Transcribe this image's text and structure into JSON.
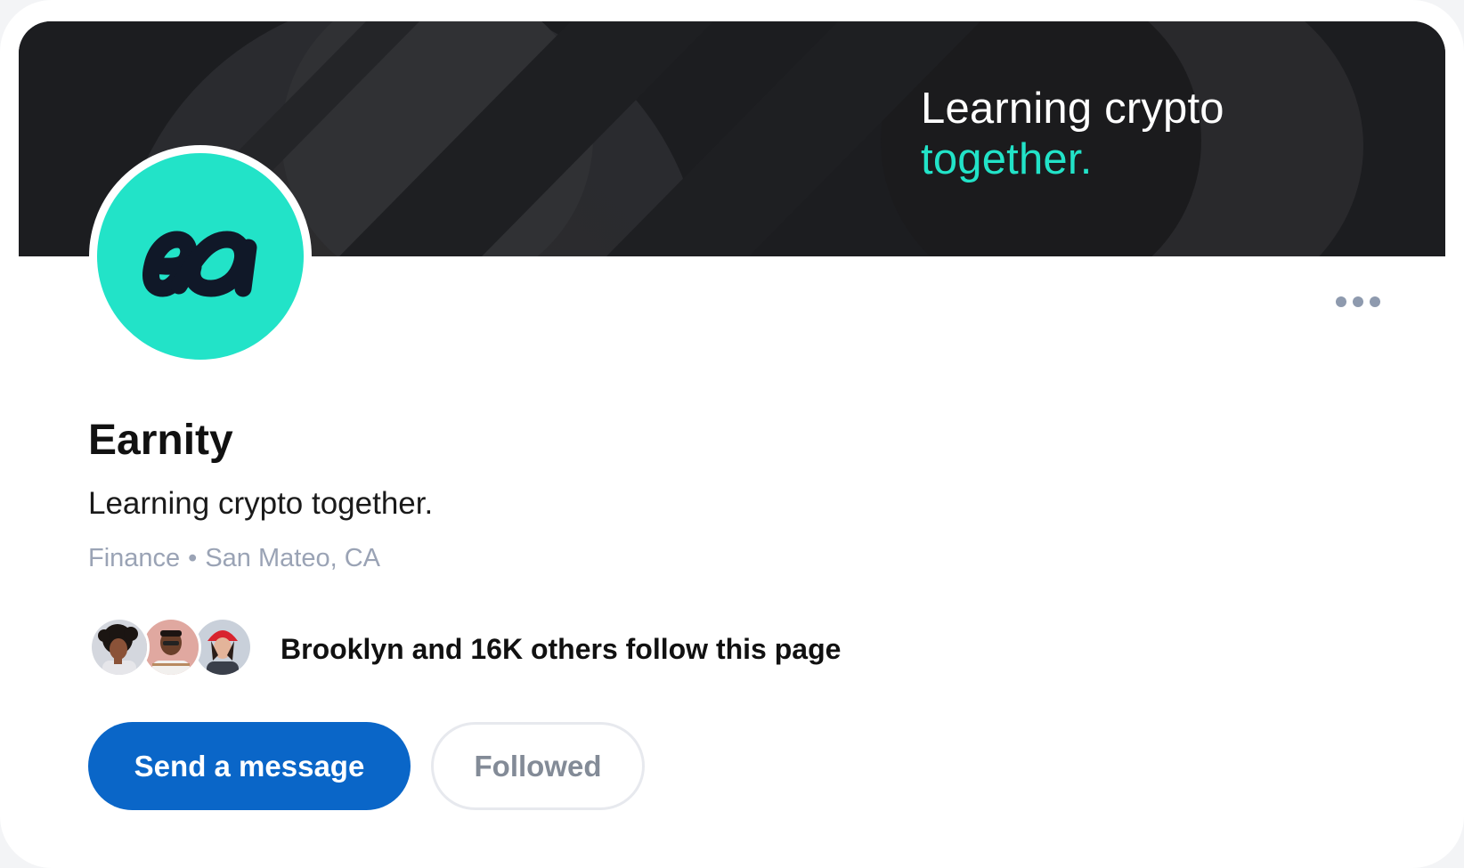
{
  "banner": {
    "line1": "Learning crypto",
    "line2": "together."
  },
  "logo": {
    "text": "ea",
    "color": "#22e3c8"
  },
  "more_icon": "more-horizontal-icon",
  "company": {
    "name": "Earnity",
    "tagline": "Learning crypto together.",
    "industry": "Finance",
    "separator": "•",
    "location": "San Mateo, CA"
  },
  "followers": {
    "text": "Brooklyn and 16K others follow this page",
    "avatars": [
      "avatar-1",
      "avatar-2",
      "avatar-3"
    ]
  },
  "actions": {
    "message_label": "Send a message",
    "follow_label": "Followed"
  },
  "colors": {
    "accent": "#22e3c8",
    "primary_button": "#0a66c8",
    "banner_bg": "#1c1d20"
  }
}
